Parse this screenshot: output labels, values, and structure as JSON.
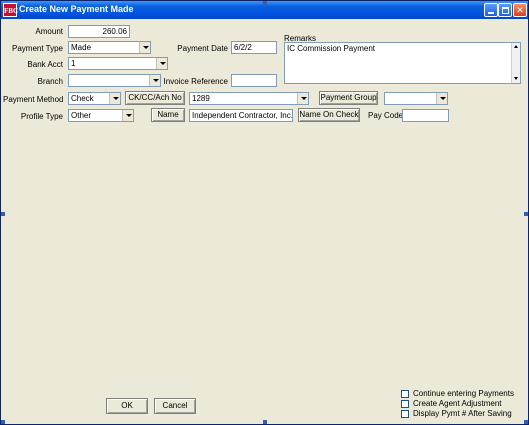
{
  "window": {
    "icon_text": "FBC",
    "title": "Create New Payment Made"
  },
  "form": {
    "amount_label": "Amount",
    "amount_value": "260.06",
    "payment_type_label": "Payment Type",
    "payment_type_value": "Made",
    "payment_date_label": "Payment Date",
    "payment_date_value": "6/2/2",
    "remarks_label": "Remarks",
    "remarks_value": "IC Commission Payment",
    "bank_acct_label": "Bank Acct",
    "bank_acct_value": "1",
    "branch_label": "Branch",
    "branch_value": "",
    "invoice_reference_label": "Invoice Reference",
    "invoice_reference_value": "",
    "payment_method_label": "Payment Method",
    "payment_method_value": "Check",
    "ck_cc_ach_button": "CK/CC/Ach No",
    "ck_cc_ach_value": "1289",
    "payment_group_button": "Payment Group",
    "payment_group_value": "",
    "profile_type_label": "Profile Type",
    "profile_type_value": "Other",
    "name_button": "Name",
    "name_value": "Independent Contractor, Inc.",
    "name_on_check_button": "Name On Check",
    "pay_code_label": "Pay Code",
    "pay_code_value": ""
  },
  "footer": {
    "ok_label": "OK",
    "cancel_label": "Cancel",
    "options": [
      {
        "label": "Continue entering Payments",
        "checked": false
      },
      {
        "label": "Create Agent Adjustment",
        "checked": false
      },
      {
        "label": "Display Pymt # After Saving",
        "checked": false
      }
    ]
  }
}
